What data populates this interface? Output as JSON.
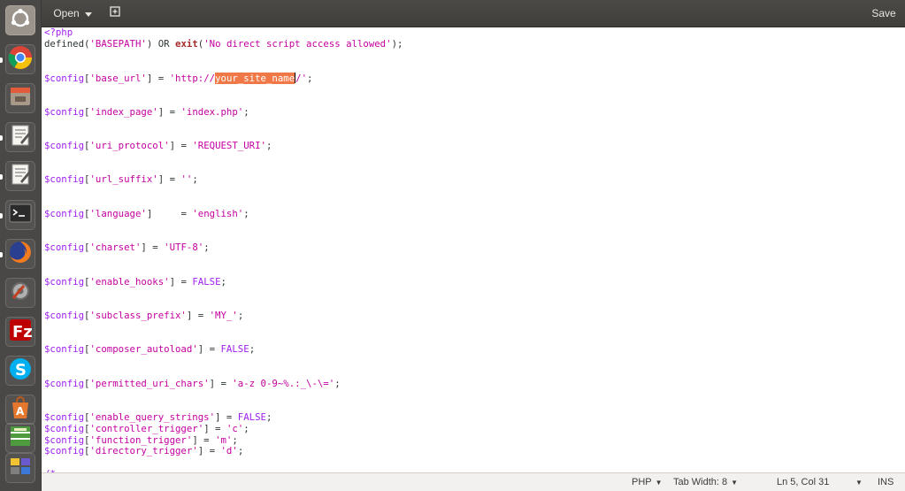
{
  "header": {
    "open_label": "Open",
    "open_icon": "chevron-down-icon",
    "new_tab_icon": "new-document-icon",
    "save_label": "Save"
  },
  "dock": {
    "items": [
      {
        "name": "ubuntu-launcher-icon",
        "color": "#c7c3bd"
      },
      {
        "name": "chrome-icon",
        "color": "#e9e9e9"
      },
      {
        "name": "file-manager-icon",
        "color": "#8c7e6f"
      },
      {
        "name": "text-editor-icon",
        "color": "#d9d6cf"
      },
      {
        "name": "text-editor-active-icon",
        "color": "#d9d6cf"
      },
      {
        "name": "terminal-icon",
        "color": "#2b2b2b"
      },
      {
        "name": "firefox-icon",
        "color": "#e8702a"
      },
      {
        "name": "system-settings-icon",
        "color": "#9b9b9b"
      },
      {
        "name": "filezilla-icon",
        "color": "#b30000"
      },
      {
        "name": "skype-icon",
        "color": "#00aff0"
      },
      {
        "name": "software-center-icon",
        "color": "#e3772e"
      },
      {
        "name": "calculator-icon",
        "color": "#4d9a3f"
      },
      {
        "name": "workspace-switcher-icon",
        "color": "#6a5acd"
      }
    ]
  },
  "editor": {
    "selected_text": "your_site_name",
    "lines": [
      [
        [
          "t-var",
          "<?php"
        ]
      ],
      [
        [
          "t-def",
          "defined("
        ],
        [
          "t-str",
          "'BASEPATH'"
        ],
        [
          "t-def",
          ") OR "
        ],
        [
          "t-kw",
          "exit"
        ],
        [
          "t-def",
          "("
        ],
        [
          "t-str",
          "'No direct script access allowed'"
        ],
        [
          "t-def",
          ");"
        ]
      ],
      [],
      [],
      [
        [
          "t-var",
          "$config"
        ],
        [
          "t-br",
          "["
        ],
        [
          "t-str",
          "'base_url'"
        ],
        [
          "t-br",
          "]"
        ],
        [
          "t-def",
          " = "
        ],
        [
          "t-str",
          "'http://"
        ],
        [
          "sel",
          "your_site_name"
        ],
        [
          "t-str",
          "/'"
        ],
        [
          "t-def",
          ";"
        ]
      ],
      [],
      [],
      [
        [
          "t-var",
          "$config"
        ],
        [
          "t-br",
          "["
        ],
        [
          "t-str",
          "'index_page'"
        ],
        [
          "t-br",
          "]"
        ],
        [
          "t-def",
          " = "
        ],
        [
          "t-str",
          "'index.php'"
        ],
        [
          "t-def",
          ";"
        ]
      ],
      [],
      [],
      [
        [
          "t-var",
          "$config"
        ],
        [
          "t-br",
          "["
        ],
        [
          "t-str",
          "'uri_protocol'"
        ],
        [
          "t-br",
          "]"
        ],
        [
          "t-def",
          " = "
        ],
        [
          "t-str",
          "'REQUEST_URI'"
        ],
        [
          "t-def",
          ";"
        ]
      ],
      [],
      [],
      [
        [
          "t-var",
          "$config"
        ],
        [
          "t-br",
          "["
        ],
        [
          "t-str",
          "'url_suffix'"
        ],
        [
          "t-br",
          "]"
        ],
        [
          "t-def",
          " = "
        ],
        [
          "t-str",
          "''"
        ],
        [
          "t-def",
          ";"
        ]
      ],
      [],
      [],
      [
        [
          "t-var",
          "$config"
        ],
        [
          "t-br",
          "["
        ],
        [
          "t-str",
          "'language'"
        ],
        [
          "t-br",
          "]"
        ],
        [
          "t-def",
          "     = "
        ],
        [
          "t-str",
          "'english'"
        ],
        [
          "t-def",
          ";"
        ]
      ],
      [],
      [],
      [
        [
          "t-var",
          "$config"
        ],
        [
          "t-br",
          "["
        ],
        [
          "t-str",
          "'charset'"
        ],
        [
          "t-br",
          "]"
        ],
        [
          "t-def",
          " = "
        ],
        [
          "t-str",
          "'UTF-8'"
        ],
        [
          "t-def",
          ";"
        ]
      ],
      [],
      [],
      [
        [
          "t-var",
          "$config"
        ],
        [
          "t-br",
          "["
        ],
        [
          "t-str",
          "'enable_hooks'"
        ],
        [
          "t-br",
          "]"
        ],
        [
          "t-def",
          " = "
        ],
        [
          "t-var",
          "FALSE"
        ],
        [
          "t-def",
          ";"
        ]
      ],
      [],
      [],
      [
        [
          "t-var",
          "$config"
        ],
        [
          "t-br",
          "["
        ],
        [
          "t-str",
          "'subclass_prefix'"
        ],
        [
          "t-br",
          "]"
        ],
        [
          "t-def",
          " = "
        ],
        [
          "t-str",
          "'MY_'"
        ],
        [
          "t-def",
          ";"
        ]
      ],
      [],
      [],
      [
        [
          "t-var",
          "$config"
        ],
        [
          "t-br",
          "["
        ],
        [
          "t-str",
          "'composer_autoload'"
        ],
        [
          "t-br",
          "]"
        ],
        [
          "t-def",
          " = "
        ],
        [
          "t-var",
          "FALSE"
        ],
        [
          "t-def",
          ";"
        ]
      ],
      [],
      [],
      [
        [
          "t-var",
          "$config"
        ],
        [
          "t-br",
          "["
        ],
        [
          "t-str",
          "'permitted_uri_chars'"
        ],
        [
          "t-br",
          "]"
        ],
        [
          "t-def",
          " = "
        ],
        [
          "t-str",
          "'a-z 0-9~%.:_\\-\\='"
        ],
        [
          "t-def",
          ";"
        ]
      ],
      [],
      [],
      [
        [
          "t-var",
          "$config"
        ],
        [
          "t-br",
          "["
        ],
        [
          "t-str",
          "'enable_query_strings'"
        ],
        [
          "t-br",
          "]"
        ],
        [
          "t-def",
          " = "
        ],
        [
          "t-var",
          "FALSE"
        ],
        [
          "t-def",
          ";"
        ]
      ],
      [
        [
          "t-var",
          "$config"
        ],
        [
          "t-br",
          "["
        ],
        [
          "t-str",
          "'controller_trigger'"
        ],
        [
          "t-br",
          "]"
        ],
        [
          "t-def",
          " = "
        ],
        [
          "t-str",
          "'c'"
        ],
        [
          "t-def",
          ";"
        ]
      ],
      [
        [
          "t-var",
          "$config"
        ],
        [
          "t-br",
          "["
        ],
        [
          "t-str",
          "'function_trigger'"
        ],
        [
          "t-br",
          "]"
        ],
        [
          "t-def",
          " = "
        ],
        [
          "t-str",
          "'m'"
        ],
        [
          "t-def",
          ";"
        ]
      ],
      [
        [
          "t-var",
          "$config"
        ],
        [
          "t-br",
          "["
        ],
        [
          "t-str",
          "'directory_trigger'"
        ],
        [
          "t-br",
          "]"
        ],
        [
          "t-def",
          " = "
        ],
        [
          "t-str",
          "'d'"
        ],
        [
          "t-def",
          ";"
        ]
      ],
      [],
      [
        [
          "t-var",
          "/*"
        ]
      ]
    ]
  },
  "status": {
    "language": "PHP",
    "tab_width": "Tab Width: 8",
    "position": "Ln 5, Col 31",
    "mode": "INS"
  }
}
